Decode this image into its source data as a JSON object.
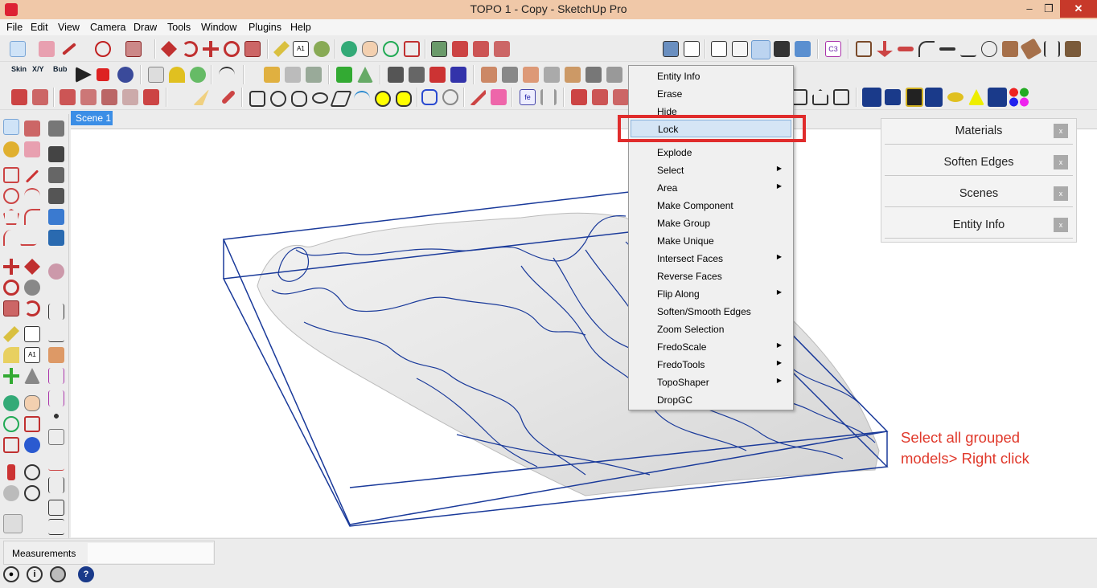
{
  "window": {
    "title": "TOPO 1 - Copy - SketchUp Pro",
    "minimize": "–",
    "maximize": "❐",
    "close": "✕"
  },
  "menubar": [
    "File",
    "Edit",
    "View",
    "Camera",
    "Draw",
    "Tools",
    "Window",
    "Plugins",
    "Help"
  ],
  "toolbar": {
    "skin_label": "Skin",
    "xy_label": "X/Y",
    "bub_label": "Bub"
  },
  "scene_tab": "Scene 1",
  "context_menu": {
    "items": [
      {
        "label": "Entity Info",
        "submenu": false
      },
      {
        "label": "Erase",
        "submenu": false
      },
      {
        "label": "Hide",
        "submenu": false
      },
      {
        "label": "Lock",
        "submenu": false,
        "highlighted": true
      },
      {
        "label": "Explode",
        "submenu": false
      },
      {
        "label": "Select",
        "submenu": true
      },
      {
        "label": "Area",
        "submenu": true
      },
      {
        "label": "Make Component",
        "submenu": false
      },
      {
        "label": "Make Group",
        "submenu": false
      },
      {
        "label": "Make Unique",
        "submenu": false
      },
      {
        "label": "Intersect Faces",
        "submenu": true
      },
      {
        "label": "Reverse Faces",
        "submenu": false
      },
      {
        "label": "Flip Along",
        "submenu": true
      },
      {
        "label": "Soften/Smooth Edges",
        "submenu": false
      },
      {
        "label": "Zoom Selection",
        "submenu": false
      },
      {
        "label": "FredoScale",
        "submenu": true
      },
      {
        "label": "FredoTools",
        "submenu": true
      },
      {
        "label": "TopoShaper",
        "submenu": true
      },
      {
        "label": "DropGC",
        "submenu": false
      }
    ],
    "submenu_arrow": "▶"
  },
  "tray": {
    "items": [
      "Materials",
      "Soften Edges",
      "Scenes",
      "Entity Info"
    ],
    "close_glyph": "x"
  },
  "annotation": {
    "line1": "Select all grouped",
    "line2": "models> Right click"
  },
  "status": {
    "measurements_label": "Measurements",
    "measurements_value": ""
  },
  "colors": {
    "highlight_box": "#e02c2c",
    "selection_blue": "#1a3a9a",
    "scene_tab": "#3b8ee6",
    "annotation": "#e0392b"
  }
}
